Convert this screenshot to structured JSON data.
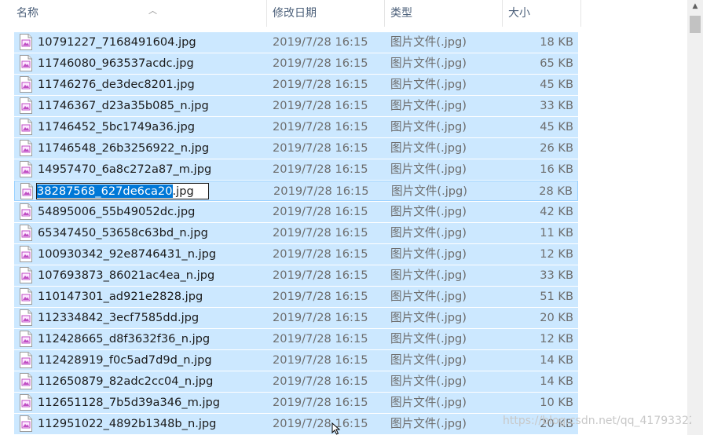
{
  "columns": {
    "name": "名称",
    "date": "修改日期",
    "type": "类型",
    "size": "大小"
  },
  "rename": {
    "selected": "38287568_627de6ca20",
    "rest": ".jpg"
  },
  "files": [
    {
      "name": "10791227_7168491604.jpg",
      "date": "2019/7/28 16:15",
      "type": "图片文件(.jpg)",
      "size": "18 KB"
    },
    {
      "name": "11746080_963537acdc.jpg",
      "date": "2019/7/28 16:15",
      "type": "图片文件(.jpg)",
      "size": "65 KB"
    },
    {
      "name": "11746276_de3dec8201.jpg",
      "date": "2019/7/28 16:15",
      "type": "图片文件(.jpg)",
      "size": "45 KB"
    },
    {
      "name": "11746367_d23a35b085_n.jpg",
      "date": "2019/7/28 16:15",
      "type": "图片文件(.jpg)",
      "size": "33 KB"
    },
    {
      "name": "11746452_5bc1749a36.jpg",
      "date": "2019/7/28 16:15",
      "type": "图片文件(.jpg)",
      "size": "45 KB"
    },
    {
      "name": "11746548_26b3256922_n.jpg",
      "date": "2019/7/28 16:15",
      "type": "图片文件(.jpg)",
      "size": "26 KB"
    },
    {
      "name": "14957470_6a8c272a87_m.jpg",
      "date": "2019/7/28 16:15",
      "type": "图片文件(.jpg)",
      "size": "16 KB"
    },
    {
      "name": "38287568_627de6ca20.jpg",
      "date": "2019/7/28 16:15",
      "type": "图片文件(.jpg)",
      "size": "28 KB"
    },
    {
      "name": "54895006_55b49052dc.jpg",
      "date": "2019/7/28 16:15",
      "type": "图片文件(.jpg)",
      "size": "42 KB"
    },
    {
      "name": "65347450_53658c63bd_n.jpg",
      "date": "2019/7/28 16:15",
      "type": "图片文件(.jpg)",
      "size": "11 KB"
    },
    {
      "name": "100930342_92e8746431_n.jpg",
      "date": "2019/7/28 16:15",
      "type": "图片文件(.jpg)",
      "size": "12 KB"
    },
    {
      "name": "107693873_86021ac4ea_n.jpg",
      "date": "2019/7/28 16:15",
      "type": "图片文件(.jpg)",
      "size": "33 KB"
    },
    {
      "name": "110147301_ad921e2828.jpg",
      "date": "2019/7/28 16:15",
      "type": "图片文件(.jpg)",
      "size": "51 KB"
    },
    {
      "name": "112334842_3ecf7585dd.jpg",
      "date": "2019/7/28 16:15",
      "type": "图片文件(.jpg)",
      "size": "20 KB"
    },
    {
      "name": "112428665_d8f3632f36_n.jpg",
      "date": "2019/7/28 16:15",
      "type": "图片文件(.jpg)",
      "size": "12 KB"
    },
    {
      "name": "112428919_f0c5ad7d9d_n.jpg",
      "date": "2019/7/28 16:15",
      "type": "图片文件(.jpg)",
      "size": "14 KB"
    },
    {
      "name": "112650879_82adc2cc04_n.jpg",
      "date": "2019/7/28 16:15",
      "type": "图片文件(.jpg)",
      "size": "14 KB"
    },
    {
      "name": "112651128_7b5d39a346_m.jpg",
      "date": "2019/7/28 16:15",
      "type": "图片文件(.jpg)",
      "size": "10 KB"
    },
    {
      "name": "112951022_4892b1348b_n.jpg",
      "date": "2019/7/28 16:15",
      "type": "图片文件(.jpg)",
      "size": "20 KB"
    }
  ],
  "watermark": "https://blog.csdn.net/qq_41793322"
}
